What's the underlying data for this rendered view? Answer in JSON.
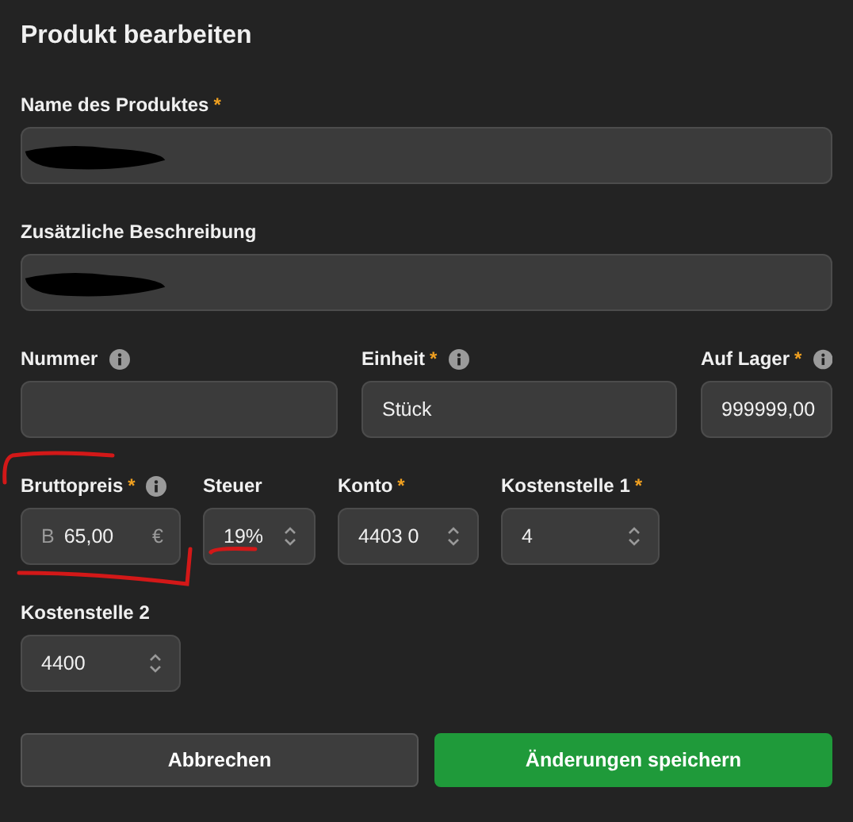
{
  "title": "Produkt bearbeiten",
  "rows": [
    [
      {
        "label": "Name des Produktes",
        "required_mark": "*",
        "info": false,
        "kind": "text",
        "redacted": true
      }
    ],
    [
      {
        "label": "Zusätzliche Beschreibung",
        "info": false,
        "kind": "text",
        "redacted": true
      }
    ],
    [
      {
        "label": "Nummer",
        "info": true,
        "kind": "text",
        "redacted": false
      },
      {
        "label": "Einheit",
        "required_mark": "*",
        "info": true,
        "kind": "text",
        "value": "Stück",
        "redacted": false
      },
      {
        "label": "Auf Lager",
        "required_mark": "*",
        "info": true,
        "kind": "text",
        "value": "999999,00",
        "redacted": false
      }
    ],
    [
      {
        "label": "Bruttopreis",
        "required_mark": "*",
        "info": true,
        "kind": "money",
        "prefix": "B",
        "value": "65,00",
        "suffix": "€",
        "redacted": false
      },
      {
        "label": "Steuer",
        "info": false,
        "kind": "select",
        "value": "19%",
        "redacted": false
      },
      {
        "label": "Konto",
        "required_mark": "*",
        "info": false,
        "kind": "select",
        "value": "4403 0",
        "redacted": false
      },
      {
        "label": "Kostenstelle 1",
        "required_mark": "*",
        "info": false,
        "kind": "select",
        "value": "4",
        "redacted": false
      }
    ],
    [
      {
        "label": "Kostenstelle 2",
        "info": false,
        "kind": "select",
        "value": "4400",
        "redacted": false
      }
    ]
  ],
  "hand_annotations": true,
  "buttons": [
    {
      "label": "Abbrechen",
      "kind": "secondary"
    },
    {
      "label": "Änderungen speichern",
      "kind": "primary"
    }
  ]
}
